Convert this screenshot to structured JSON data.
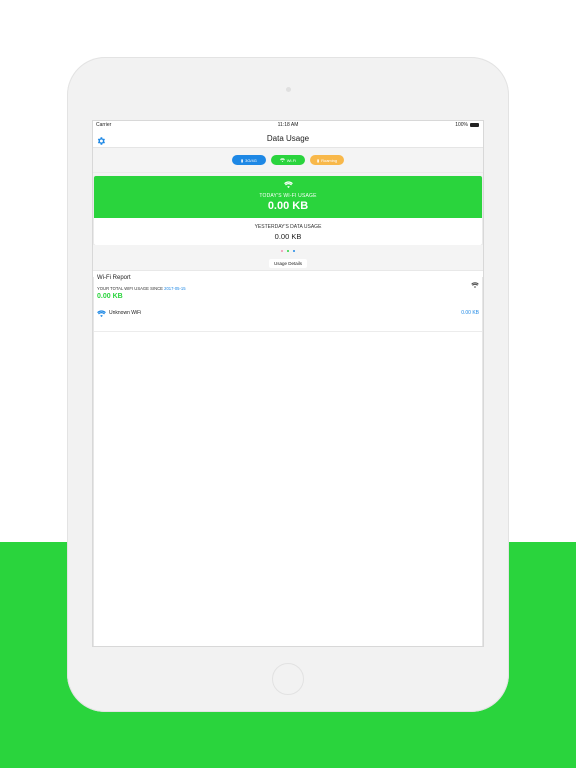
{
  "status_bar": {
    "carrier": "Carrier",
    "time": "11:18 AM",
    "battery": "100%"
  },
  "nav": {
    "title": "Data Usage"
  },
  "toggles": [
    {
      "label": "3G/4G",
      "color": "#1e88e5"
    },
    {
      "label": "Wi-Fi",
      "color": "#2ad43d"
    },
    {
      "label": "Roaming",
      "color": "#f8b84a"
    }
  ],
  "summary_card": {
    "today_label": "TODAY'S WI-FI USAGE",
    "today_value": "0.00 KB",
    "yesterday_label": "YESTERDAY'S DATA USAGE",
    "yesterday_value": "0.00 KB"
  },
  "pager": {
    "count": 3,
    "active_index": 1,
    "dot_colors": [
      "#f48fb1",
      "#2ad43d",
      "#1e88e5"
    ]
  },
  "section": {
    "title": "Usage Details"
  },
  "report": {
    "title": "Wi-Fi Report",
    "total_prefix": "YOUR TOTAL WIFI USAGE SINCE",
    "total_since": "2017-05-15",
    "total_value": "0.00 KB",
    "networks": [
      {
        "name": "Unknown WiFi",
        "value": "0.00 KB"
      }
    ]
  },
  "colors": {
    "accent_green": "#2ad43d",
    "accent_blue": "#1e88e5",
    "accent_orange": "#f8b84a"
  },
  "icons": {
    "settings": "gear-icon",
    "wifi": "wifi-icon"
  }
}
